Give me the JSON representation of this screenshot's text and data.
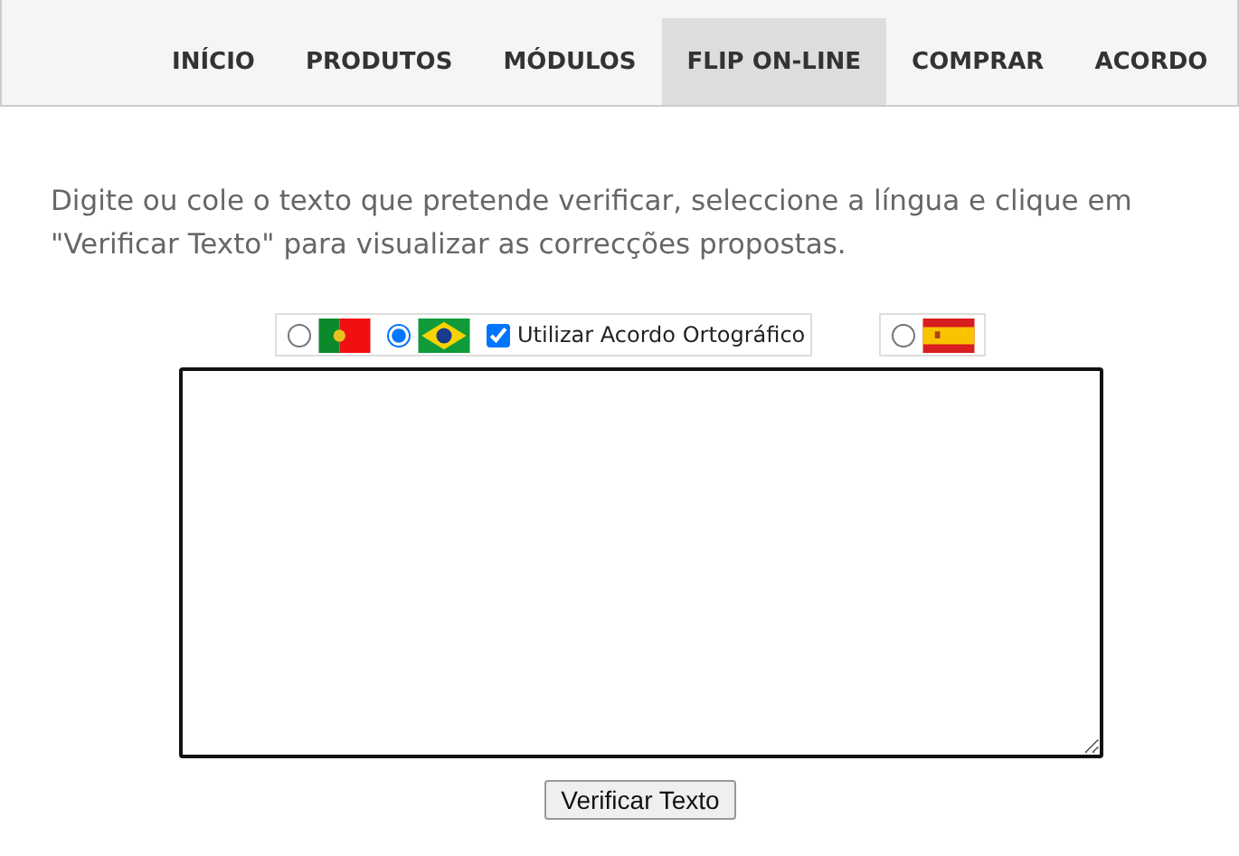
{
  "nav": {
    "items": [
      {
        "label": "INÍCIO",
        "selected": false
      },
      {
        "label": "PRODUTOS",
        "selected": false
      },
      {
        "label": "MÓDULOS",
        "selected": false
      },
      {
        "label": "FLIP ON-LINE",
        "selected": true
      },
      {
        "label": "COMPRAR",
        "selected": false
      },
      {
        "label": "ACORDO",
        "selected": false
      }
    ]
  },
  "intro": "Digite ou cole o texto que pretende verificar, seleccione a língua e clique em \"Verificar Texto\" para visualizar as correcções propostas.",
  "languages": [
    {
      "kind": "portugal",
      "selected": false
    },
    {
      "kind": "brazil",
      "selected": true
    },
    {
      "kind": "spain",
      "selected": false
    }
  ],
  "agreement": {
    "label": "Utilizar Acordo Ortográfico",
    "checked": true
  },
  "button": "Verificar Texto"
}
